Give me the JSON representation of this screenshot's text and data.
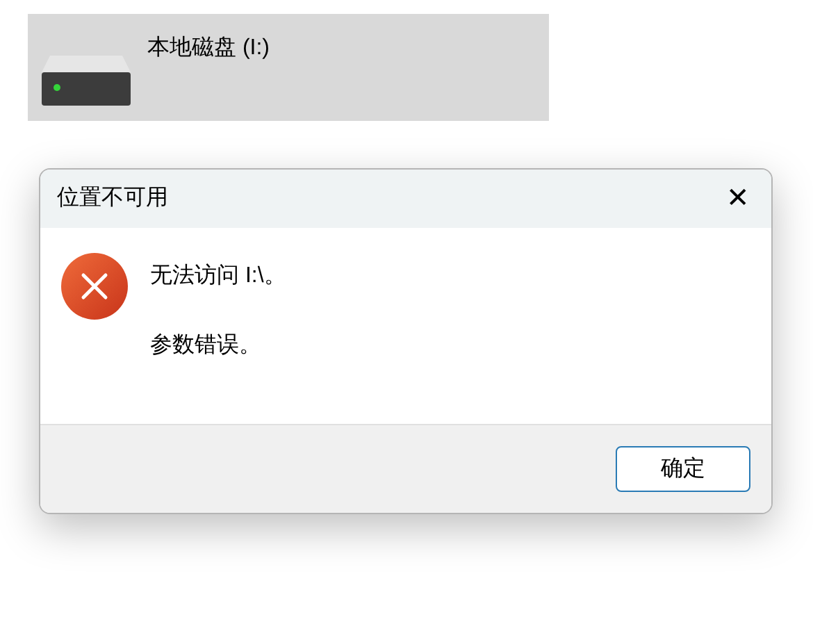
{
  "drive": {
    "label": "本地磁盘 (I:)",
    "selected": true
  },
  "dialog": {
    "title": "位置不可用",
    "close": "✕",
    "messages": [
      "无法访问 I:\\。",
      "参数错误。"
    ],
    "buttons": [
      "确定"
    ]
  }
}
